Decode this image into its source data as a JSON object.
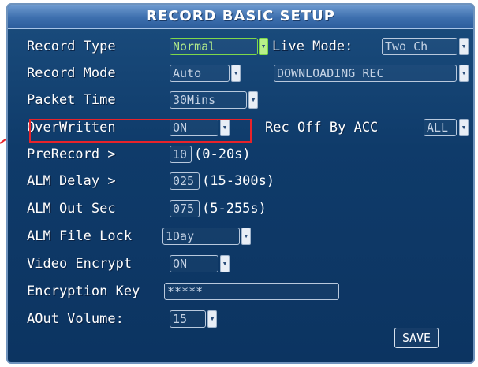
{
  "title": "RECORD BASIC SETUP",
  "rows": {
    "record_type": {
      "label": "Record Type",
      "value": "Normal"
    },
    "live_mode": {
      "label": "Live Mode:",
      "value": "Two Ch"
    },
    "record_mode": {
      "label": "Record Mode",
      "value": "Auto"
    },
    "downloading": {
      "value": "DOWNLOADING REC"
    },
    "packet_time": {
      "label": "Packet Time",
      "value": "30Mins"
    },
    "overwritten": {
      "label": "OverWritten",
      "value": "ON"
    },
    "rec_off_acc": {
      "label": "Rec Off By ACC",
      "value": "ALL"
    },
    "prerecord": {
      "label": "PreRecord >",
      "value": "10",
      "range": "(0-20s)"
    },
    "alm_delay": {
      "label": "ALM Delay >",
      "value": "025",
      "range": "(15-300s)"
    },
    "alm_out_sec": {
      "label": "ALM Out Sec",
      "value": "075",
      "range": "(5-255s)"
    },
    "alm_file_lock": {
      "label": "ALM File Lock",
      "value": "1Day"
    },
    "video_encrypt": {
      "label": "Video Encrypt",
      "value": "ON"
    },
    "encryption_key": {
      "label": "Encryption Key",
      "value": "*****"
    },
    "aout_volume": {
      "label": "AOut Volume:",
      "value": "15"
    }
  },
  "save_label": "SAVE",
  "dropdown_glyph": "▾",
  "colors": {
    "highlight": "#e8232a",
    "active": "#7fd84a",
    "panel": "#0f3b6a"
  }
}
